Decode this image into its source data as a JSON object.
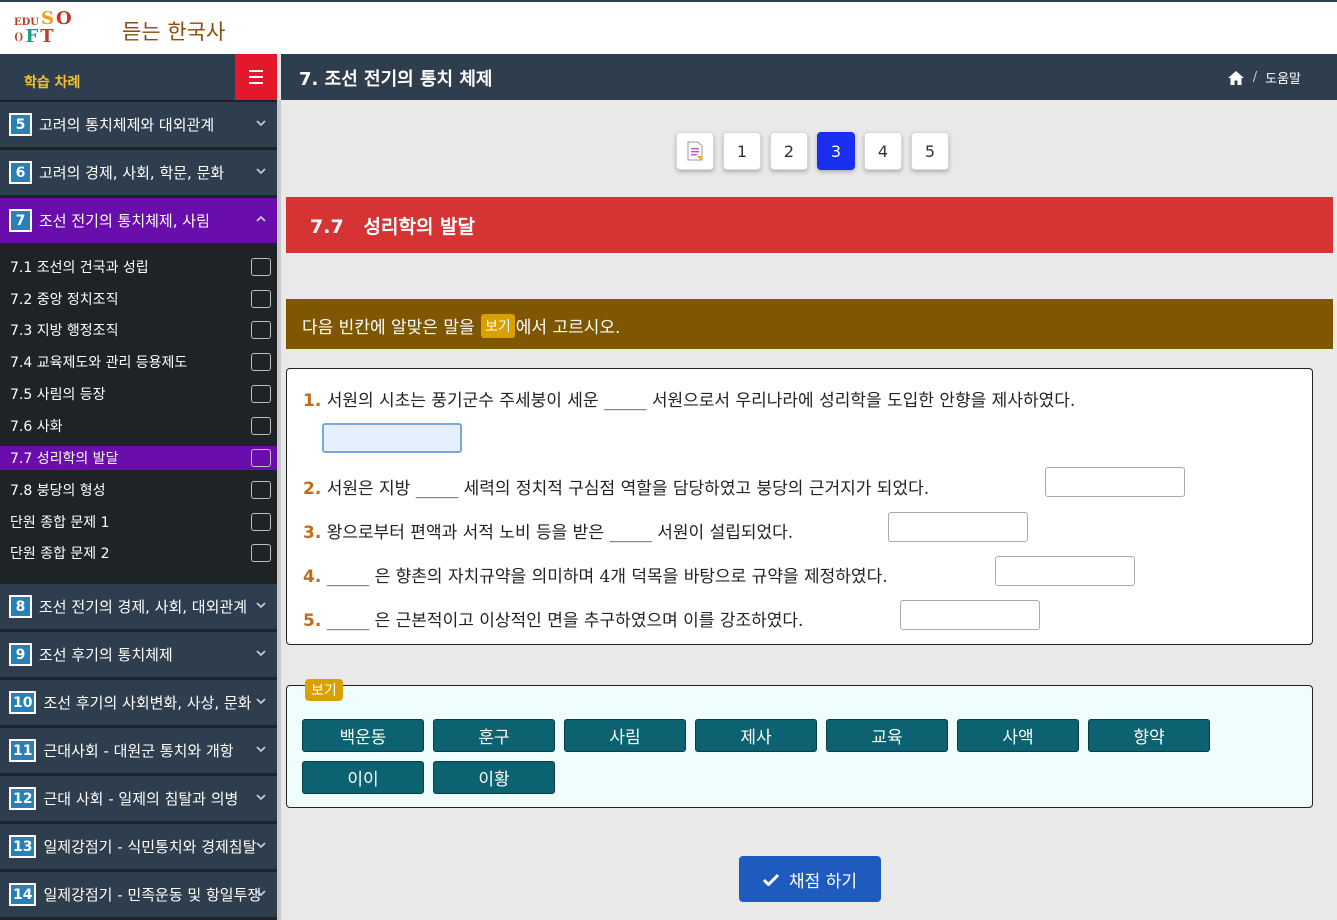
{
  "logo": {
    "row1": [
      {
        "t": "EDU",
        "c": "#c0392b",
        "cls": "edu"
      },
      {
        "t": "S",
        "c": "#f39c12",
        "cls": "big"
      },
      {
        "t": "O",
        "c": "#c0392b",
        "cls": "big"
      }
    ],
    "row2": [
      {
        "t": "()",
        "c": "#c0392b",
        "cls": "edu"
      },
      {
        "t": "F",
        "c": "#16a085",
        "cls": "big"
      },
      {
        "t": "T",
        "c": "#c0392b",
        "cls": "big"
      }
    ]
  },
  "app": {
    "title": "듣는 한국사"
  },
  "sidebar": {
    "title": "학습 차례",
    "chapters_top": [
      {
        "num": "5",
        "label": "고려의 통치체제와 대외관계",
        "active": false,
        "expanded": false
      },
      {
        "num": "6",
        "label": "고려의 경제, 사회, 학문, 문화",
        "active": false,
        "expanded": false
      },
      {
        "num": "7",
        "label": "조선 전기의 통치체제, 사림",
        "active": true,
        "expanded": true
      }
    ],
    "lessons": [
      {
        "label": "7.1 조선의 건국과 성립",
        "active": false
      },
      {
        "label": "7.2 중앙 정치조직",
        "active": false
      },
      {
        "label": "7.3 지방 행정조직",
        "active": false
      },
      {
        "label": "7.4 교육제도와 관리 등용제도",
        "active": false
      },
      {
        "label": "7.5 사림의 등장",
        "active": false
      },
      {
        "label": "7.6 사화",
        "active": false
      },
      {
        "label": "7.7 성리학의 발달",
        "active": true
      },
      {
        "label": "7.8 붕당의 형성",
        "active": false
      },
      {
        "label": "단원 종합 문제 1",
        "active": false
      },
      {
        "label": "단원 종합 문제 2",
        "active": false
      }
    ],
    "chapters_bottom": [
      {
        "num": "8",
        "label": "조선 전기의 경제, 사회, 대외관계",
        "active": false
      },
      {
        "num": "9",
        "label": "조선 후기의 통치체제",
        "active": false
      },
      {
        "num": "10",
        "label": "조선 후기의 사회변화, 사상, 문화",
        "active": false
      },
      {
        "num": "11",
        "label": "근대사회 - 대원군 통치와 개항",
        "active": false
      },
      {
        "num": "12",
        "label": "근대 사회 - 일제의 침탈과 의병",
        "active": false
      },
      {
        "num": "13",
        "label": "일제강점기 - 식민통치와 경제침탈",
        "active": false
      },
      {
        "num": "14",
        "label": "일제강점기 - 민족운동 및 항일투쟁",
        "active": false
      }
    ]
  },
  "main": {
    "title": "7. 조선 전기의 통치 체제",
    "breadcrumb": {
      "sep": "/",
      "help": "도움말"
    }
  },
  "pager": {
    "pages": [
      "1",
      "2",
      "3",
      "4",
      "5"
    ],
    "current": "3"
  },
  "section": {
    "title": "7.7   성리학의 발달"
  },
  "instruction": {
    "before": "다음 빈칸에 알맞은 말을 ",
    "badge": "보기",
    "after": "에서 고르시오."
  },
  "questions": [
    {
      "num": "1.",
      "text": " 서원의 시초는 풍기군수 주세붕이 세운 _____ 서원으로서 우리나라에 성리학을 도입한 안향을 제사하였다.",
      "answer": ""
    },
    {
      "num": "2.",
      "text": " 서원은 지방 _____ 세력의 정치적 구심점 역할을 담당하였고 붕당의 근거지가 되었다.",
      "answer": ""
    },
    {
      "num": "3.",
      "text": " 왕으로부터 편액과 서적 노비 등을 받은 _____ 서원이 설립되었다.",
      "answer": ""
    },
    {
      "num": "4.",
      "text": " _____ 은 향촌의 자치규약을 의미하며 4개 덕목을 바탕으로 규약을 제정하였다.",
      "answer": ""
    },
    {
      "num": "5.",
      "text": " _____ 은 근본적이고 이상적인 면을 추구하였으며 이를 강조하였다.",
      "answer": ""
    }
  ],
  "wordbank": {
    "badge": "보기",
    "words": [
      "백운동",
      "훈구",
      "사림",
      "제사",
      "교육",
      "사액",
      "향약",
      "이이",
      "이황"
    ]
  },
  "submit": {
    "label": "채점 하기"
  },
  "colors": {
    "accent_active": "#6a0dad",
    "header": "#2f3e4e",
    "banner": "#d63434",
    "instruction": "#7f5703",
    "chip": "#0c6270",
    "submit": "#1f5bbf",
    "page_current": "#1a2ef0"
  },
  "icons": {
    "home": "home-icon",
    "menu": "hamburger-menu-icon",
    "check": "check-icon",
    "doc": "document-icon"
  }
}
